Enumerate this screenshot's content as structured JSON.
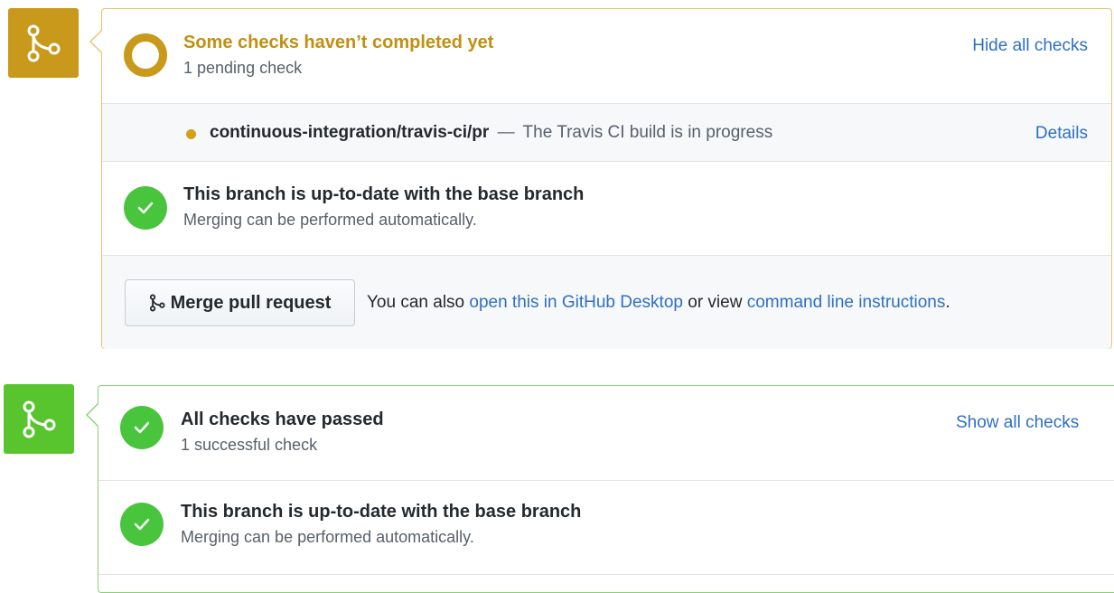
{
  "pending_box": {
    "status": {
      "title": "Some checks haven’t completed yet",
      "subtitle": "1 pending check",
      "toggle_link": "Hide all checks"
    },
    "check": {
      "name": "continuous-integration/travis-ci/pr",
      "separator": "—",
      "description": "The Travis CI build is in progress",
      "details_link": "Details"
    },
    "branch": {
      "title": "This branch is up-to-date with the base branch",
      "subtitle": "Merging can be performed automatically."
    },
    "merge": {
      "button_label": "Merge pull request",
      "text_prefix": "You can also",
      "desktop_link": "open this in GitHub Desktop",
      "text_middle": "or view",
      "cli_link": "command line instructions",
      "text_suffix": "."
    }
  },
  "passed_box": {
    "status": {
      "title": "All checks have passed",
      "subtitle": "1 successful check",
      "toggle_link": "Show all checks"
    },
    "branch": {
      "title": "This branch is up-to-date with the base branch",
      "subtitle": "Merging can be performed automatically."
    }
  },
  "icons": {
    "merge": "git-merge-icon",
    "pending": "pending-ring-icon",
    "dot": "pending-dot-icon",
    "check": "check-icon"
  },
  "colors": {
    "pending": "#c8991a",
    "success": "#48c43d",
    "link": "#2f6fc3",
    "pending_border": "#e6c46e",
    "success_border": "#8bd176"
  }
}
